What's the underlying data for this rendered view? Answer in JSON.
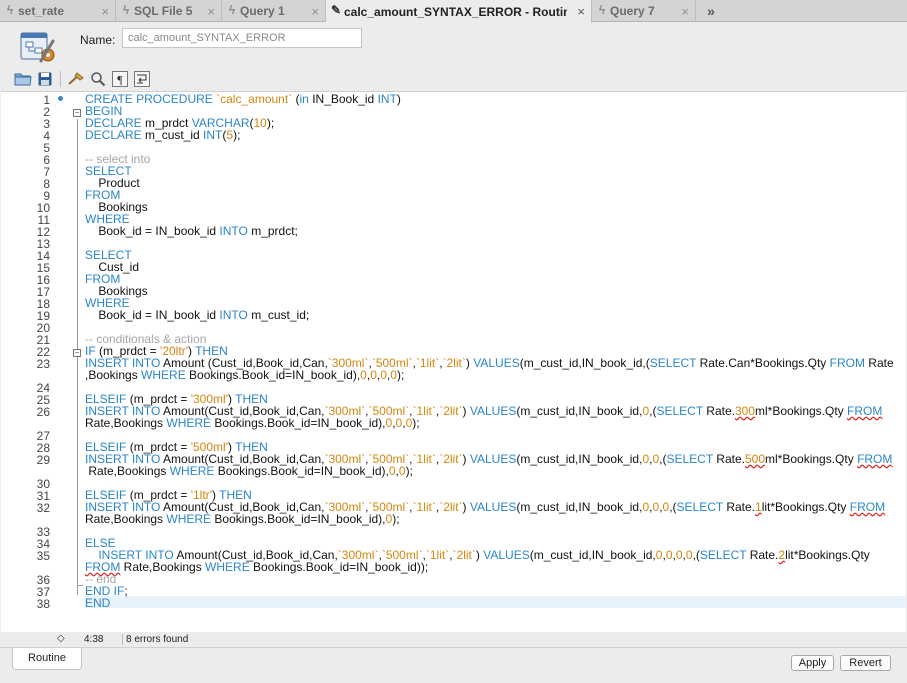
{
  "tabs": [
    {
      "label": "set_rate",
      "icon": "lightning-icon",
      "active": false
    },
    {
      "label": "SQL File 5",
      "icon": "lightning-icon",
      "active": false
    },
    {
      "label": "Query 1",
      "icon": "lightning-icon",
      "active": false
    },
    {
      "label": "calc_amount_SYNTAX_ERROR - Routine",
      "icon": "wrench-icon",
      "active": true
    },
    {
      "label": "Query 7",
      "icon": "lightning-icon",
      "active": false
    }
  ],
  "tab_close_glyph": "×",
  "overflow_glyph": "»",
  "header": {
    "name_label": "Name:",
    "name_value": "calc_amount_SYNTAX_ERROR"
  },
  "toolbar": {
    "icons": [
      "folder-open-icon",
      "save-icon",
      "beautify-icon",
      "find-icon",
      "invisible-chars-icon",
      "wrap-icon"
    ]
  },
  "editor": {
    "lines": [
      {
        "n": "1",
        "html": "<span class='kw'>CREATE PROCEDURE</span> <span class='str'>`calc_amount`</span> (<span class='kw'>in</span> IN_Book_id <span class='kw'>INT</span>)"
      },
      {
        "n": "2",
        "html": "<span class='kw'>BEGIN</span>"
      },
      {
        "n": "3",
        "html": "<span class='kw'>DECLARE</span> m_prdct <span class='kw'>VARCHAR</span>(<span class='num'>10</span>);"
      },
      {
        "n": "4",
        "html": "<span class='kw'>DECLARE</span> m_cust_id <span class='kw'>INT</span>(<span class='num'>5</span>);"
      },
      {
        "n": "5",
        "html": ""
      },
      {
        "n": "6",
        "html": "<span class='cm'>-- select into</span>"
      },
      {
        "n": "7",
        "html": "<span class='kw'>SELECT</span>"
      },
      {
        "n": "8",
        "html": "    Product"
      },
      {
        "n": "9",
        "html": "<span class='kw'>FROM</span>"
      },
      {
        "n": "10",
        "html": "    Bookings"
      },
      {
        "n": "11",
        "html": "<span class='kw'>WHERE</span>"
      },
      {
        "n": "12",
        "html": "    Book_id = IN_book_id <span class='kw'>INTO</span> m_prdct;"
      },
      {
        "n": "13",
        "html": ""
      },
      {
        "n": "14",
        "html": "<span class='kw'>SELECT</span>"
      },
      {
        "n": "15",
        "html": "    Cust_id"
      },
      {
        "n": "16",
        "html": "<span class='kw'>FROM</span>"
      },
      {
        "n": "17",
        "html": "    Bookings"
      },
      {
        "n": "18",
        "html": "<span class='kw'>WHERE</span>"
      },
      {
        "n": "19",
        "html": "    Book_id = IN_book_id <span class='kw'>INTO</span> m_cust_id;"
      },
      {
        "n": "20",
        "html": ""
      },
      {
        "n": "21",
        "html": "<span class='cm'>-- conditionals &amp; action</span>"
      },
      {
        "n": "22",
        "html": "<span class='kw'>IF</span> (m_prdct = <span class='str'>'20ltr'</span>) <span class='kw'>THEN</span>"
      },
      {
        "n": "23",
        "html": "<span class='kw'>INSERT INTO</span> Amount (Cust_id,Book_id,Can,<span class='str'>`300ml`</span>,<span class='str'>`500ml`</span>,<span class='str'>`1lit`</span>,<span class='str'>`2lit`</span>) <span class='kw'>VALUES</span>(m_cust_id,IN_book_id,(<span class='kw'>SELECT</span> Rate.Can*Bookings.Qty <span class='kw'>FROM</span> Rate"
      },
      {
        "n": "",
        "html": ",Bookings <span class='kw'>WHERE</span> Bookings.Book_id=IN_book_id),<span class='num'>0</span>,<span class='num'>0</span>,<span class='num'>0</span>,<span class='num'>0</span>);"
      },
      {
        "n": "24",
        "html": ""
      },
      {
        "n": "25",
        "html": "<span class='kw'>ELSEIF</span> (m_prdct = <span class='str'>'300ml'</span>) <span class='kw'>THEN</span>"
      },
      {
        "n": "26",
        "html": "<span class='kw'>INSERT INTO</span> Amount(Cust_id,Book_id,Can,<span class='str'>`300ml`</span>,<span class='str'>`500ml`</span>,<span class='str'>`1lit`</span>,<span class='str'>`2lit`</span>) <span class='kw'>VALUES</span>(m_cust_id,IN_book_id,<span class='num'>0</span>,(<span class='kw'>SELECT</span> Rate.<span class='num err'>300</span>ml*Bookings.Qty <span class='kw err'>FROM</span>"
      },
      {
        "n": "",
        "html": "Rate,Bookings <span class='kw'>WHERE</span> Bookings.Book_id=IN_book_id),<span class='num'>0</span>,<span class='num'>0</span>,<span class='num'>0</span>);"
      },
      {
        "n": "27",
        "html": ""
      },
      {
        "n": "28",
        "html": "<span class='kw'>ELSEIF</span> (m_prdct = <span class='str'>'500ml'</span>) <span class='kw'>THEN</span>"
      },
      {
        "n": "29",
        "html": "<span class='kw'>INSERT INTO</span> Amount(Cust_id,Book_id,Can,<span class='str'>`300ml`</span>,<span class='str'>`500ml`</span>,<span class='str'>`1lit`</span>,<span class='str'>`2lit`</span>) <span class='kw'>VALUES</span>(m_cust_id,IN_book_id,<span class='num'>0</span>,<span class='num'>0</span>,(<span class='kw'>SELECT</span> Rate.<span class='num err'>500</span>ml*Bookings.Qty <span class='kw err'>FROM</span>"
      },
      {
        "n": "",
        "html": " Rate,Bookings <span class='kw'>WHERE</span> Bookings.Book_id=IN_book_id),<span class='num'>0</span>,<span class='num'>0</span>);"
      },
      {
        "n": "30",
        "html": ""
      },
      {
        "n": "31",
        "html": "<span class='kw'>ELSEIF</span> (m_prdct = <span class='str'>'1ltr'</span>) <span class='kw'>THEN</span>"
      },
      {
        "n": "32",
        "html": "<span class='kw'>INSERT INTO</span> Amount(Cust_id,Book_id,Can,<span class='str'>`300ml`</span>,<span class='str'>`500ml`</span>,<span class='str'>`1lit`</span>,<span class='str'>`2lit`</span>) <span class='kw'>VALUES</span>(m_cust_id,IN_book_id,<span class='num'>0</span>,<span class='num'>0</span>,<span class='num'>0</span>,(<span class='kw'>SELECT</span> Rate.<span class='num err'>1</span>lit*Bookings.Qty <span class='kw err'>FROM</span>"
      },
      {
        "n": "",
        "html": "Rate,Bookings <span class='kw'>WHERE</span> Bookings.Book_id=IN_book_id),<span class='num'>0</span>);"
      },
      {
        "n": "33",
        "html": ""
      },
      {
        "n": "34",
        "html": "<span class='kw'>ELSE</span>"
      },
      {
        "n": "35",
        "html": "    <span class='kw'>INSERT INTO</span> Amount(Cust_id,Book_id,Can,<span class='str'>`300ml`</span>,<span class='str'>`500ml`</span>,<span class='str'>`1lit`</span>,<span class='str'>`2lit`</span>) <span class='kw'>VALUES</span>(m_cust_id,IN_book_id,<span class='num'>0</span>,<span class='num'>0</span>,<span class='num'>0</span>,<span class='num'>0</span>,(<span class='kw'>SELECT</span> Rate.<span class='num err'>2</span>lit*Bookings.Qty"
      },
      {
        "n": "",
        "html": "<span class='kw err'>FROM</span> Rate,Bookings <span class='kw'>WHERE</span> Bookings.Book_id=IN_book_id));"
      },
      {
        "n": "36",
        "html": "<span class='cm'>-- end</span>"
      },
      {
        "n": "37",
        "html": "<span class='kw'>END IF</span>;"
      },
      {
        "n": "38",
        "html": "<span class='kw'>END</span>"
      }
    ]
  },
  "status": {
    "position": "4:38",
    "errors": "8 errors found"
  },
  "bottom": {
    "tab_label": "Routine",
    "apply_label": "Apply",
    "revert_label": "Revert"
  }
}
